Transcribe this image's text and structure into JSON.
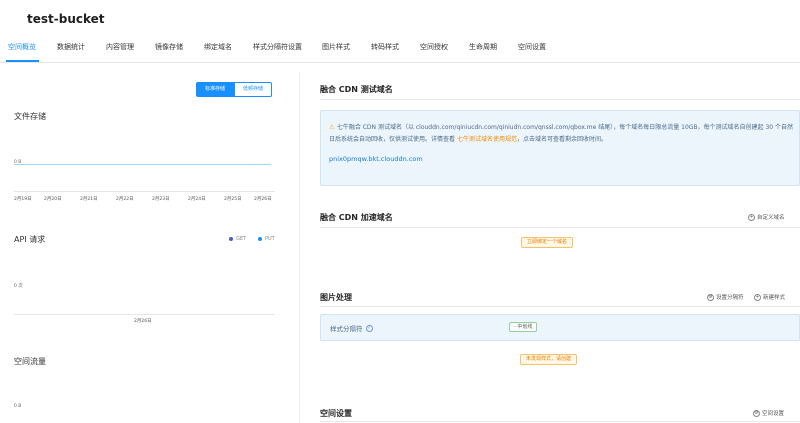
{
  "bucket": {
    "name": "test-bucket"
  },
  "tabs": [
    {
      "label": "空间概览",
      "active": true
    },
    {
      "label": "数据统计"
    },
    {
      "label": "内容管理"
    },
    {
      "label": "镜像存储"
    },
    {
      "label": "绑定域名"
    },
    {
      "label": "样式分隔符设置"
    },
    {
      "label": "图片样式"
    },
    {
      "label": "转码样式"
    },
    {
      "label": "空间授权"
    },
    {
      "label": "生命周期"
    },
    {
      "label": "空间设置"
    }
  ],
  "left": {
    "toggle": {
      "standard": "标准存储",
      "low_freq": "低频存储"
    },
    "storage": {
      "title": "文件存储",
      "y_label": "0 B",
      "x_labels": [
        "2月19日",
        "2月20日",
        "2月21日",
        "2月22日",
        "2月23日",
        "2月24日",
        "2月25日",
        "2月26日"
      ]
    },
    "api": {
      "title": "API 请求",
      "legend": [
        {
          "name": "GET",
          "color": "#4a5cd8"
        },
        {
          "name": "PUT",
          "color": "#1890ff"
        }
      ],
      "y_label": "0 次",
      "x_label": "2月26日"
    },
    "traffic": {
      "title": "空间流量",
      "y_label": "0 B"
    }
  },
  "right": {
    "test_domain": {
      "title": "融合 CDN 测试域名",
      "notice_before": "七牛融合 CDN 测试域名（以 clouddn.com/qiniucdn.com/qiniudn.com/qnssl.com/qbox.me 结尾），每个域名每日限总流量 10GB，每个测试域名自创建起 30 个自然日后系统会自动回收，仅供测试使用。详情查看",
      "notice_link": "七牛测试域名使用规范",
      "notice_after": "，点击域名可查看剩余回收时间。",
      "domain": "pnix0pmqw.bkt.clouddn.com"
    },
    "accel_domain": {
      "title": "融合 CDN 加速域名",
      "custom_action": "自定义域名",
      "bind_button": "立即绑定一个域名"
    },
    "image": {
      "title": "图片处理",
      "separator_action": "设置分隔符",
      "new_style_action": "新建样式",
      "style_label": "样式分隔符",
      "separator_tag": "- 中划线",
      "empty_button": "未发现样式，请创建"
    },
    "settings": {
      "title": "空间设置",
      "action": "空间设置"
    }
  }
}
